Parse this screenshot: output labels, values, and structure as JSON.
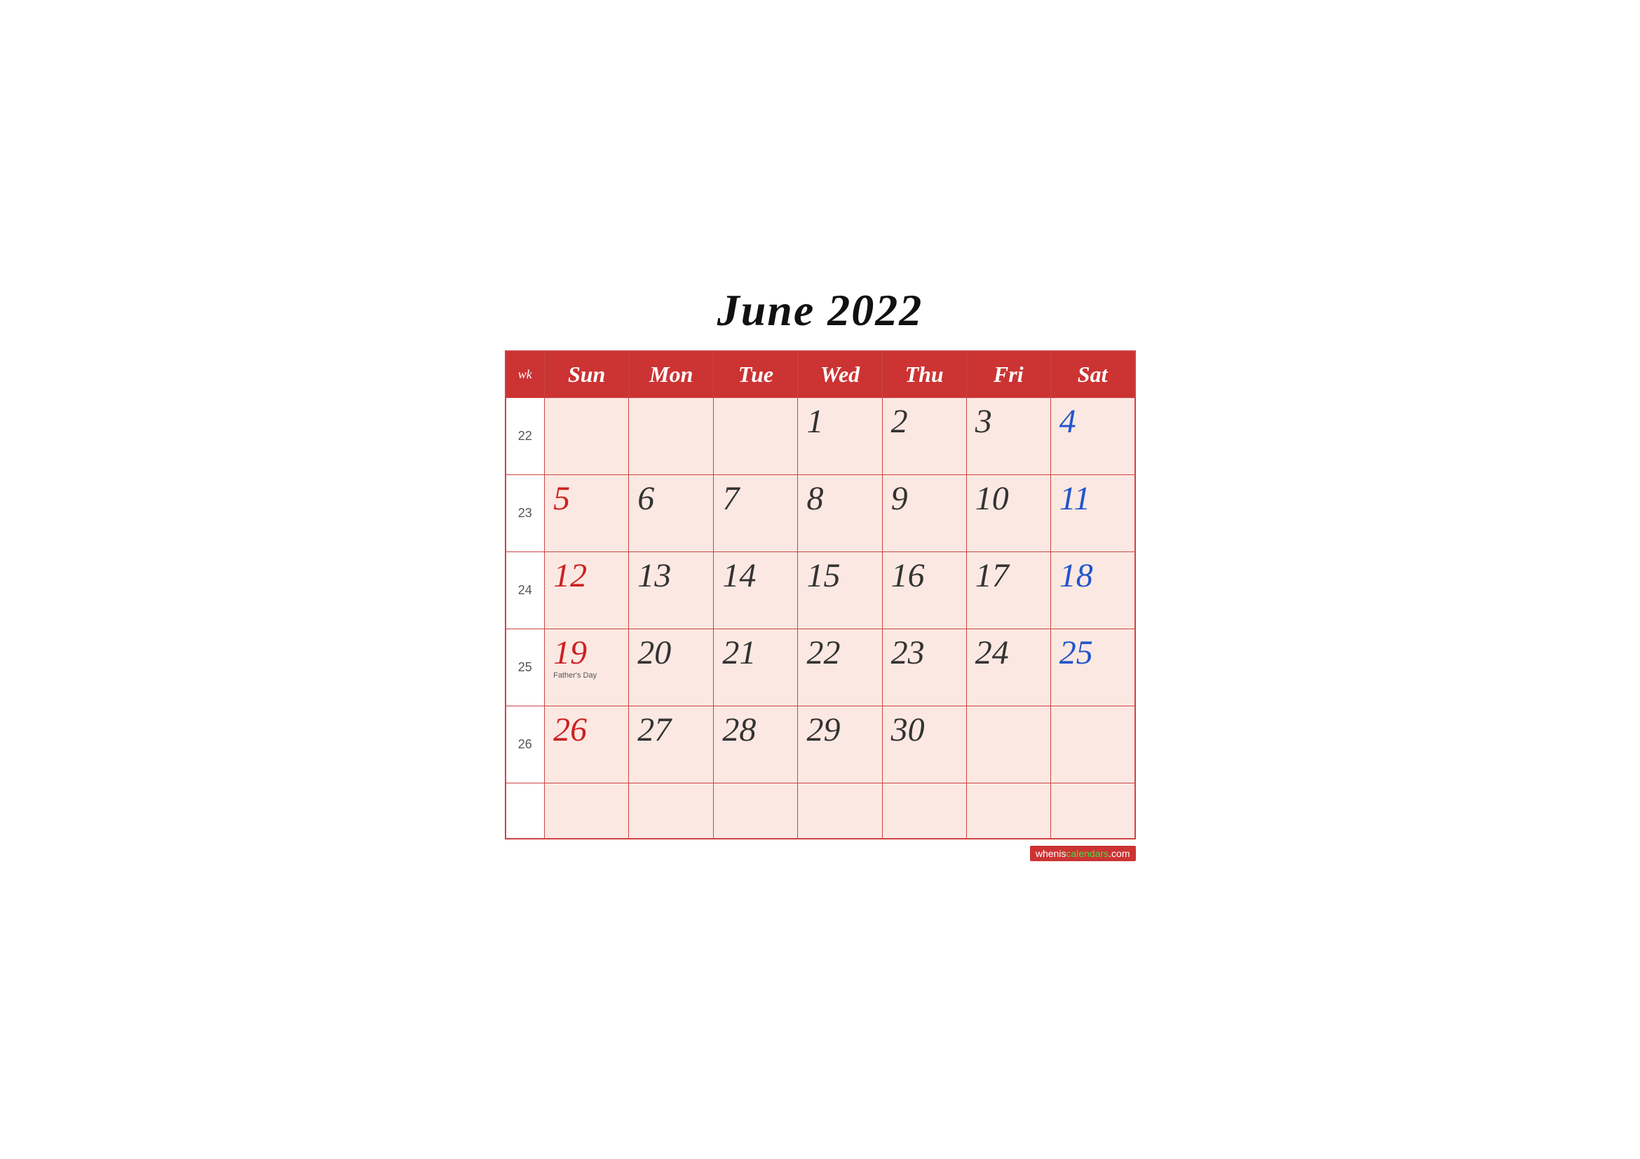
{
  "title": "June 2022",
  "header": {
    "wk": "wk",
    "days": [
      "Sun",
      "Mon",
      "Tue",
      "Wed",
      "Thu",
      "Fri",
      "Sat"
    ]
  },
  "weeks": [
    {
      "wk": "22",
      "days": [
        {
          "num": "",
          "type": "empty"
        },
        {
          "num": "",
          "type": "empty"
        },
        {
          "num": "",
          "type": "empty"
        },
        {
          "num": "1",
          "type": "weekday"
        },
        {
          "num": "2",
          "type": "weekday"
        },
        {
          "num": "3",
          "type": "weekday"
        },
        {
          "num": "4",
          "type": "saturday"
        }
      ]
    },
    {
      "wk": "23",
      "days": [
        {
          "num": "5",
          "type": "sunday"
        },
        {
          "num": "6",
          "type": "weekday"
        },
        {
          "num": "7",
          "type": "weekday"
        },
        {
          "num": "8",
          "type": "weekday"
        },
        {
          "num": "9",
          "type": "weekday"
        },
        {
          "num": "10",
          "type": "weekday"
        },
        {
          "num": "11",
          "type": "saturday"
        }
      ]
    },
    {
      "wk": "24",
      "days": [
        {
          "num": "12",
          "type": "sunday"
        },
        {
          "num": "13",
          "type": "weekday"
        },
        {
          "num": "14",
          "type": "weekday"
        },
        {
          "num": "15",
          "type": "weekday"
        },
        {
          "num": "16",
          "type": "weekday"
        },
        {
          "num": "17",
          "type": "weekday"
        },
        {
          "num": "18",
          "type": "saturday"
        }
      ]
    },
    {
      "wk": "25",
      "days": [
        {
          "num": "19",
          "type": "sunday",
          "event": "Father's Day"
        },
        {
          "num": "20",
          "type": "weekday"
        },
        {
          "num": "21",
          "type": "weekday"
        },
        {
          "num": "22",
          "type": "weekday"
        },
        {
          "num": "23",
          "type": "weekday"
        },
        {
          "num": "24",
          "type": "weekday"
        },
        {
          "num": "25",
          "type": "saturday"
        }
      ]
    },
    {
      "wk": "26",
      "days": [
        {
          "num": "26",
          "type": "sunday"
        },
        {
          "num": "27",
          "type": "weekday"
        },
        {
          "num": "28",
          "type": "weekday"
        },
        {
          "num": "29",
          "type": "weekday"
        },
        {
          "num": "30",
          "type": "weekday"
        },
        {
          "num": "",
          "type": "empty-end"
        },
        {
          "num": "",
          "type": "empty-end"
        }
      ]
    },
    {
      "wk": "",
      "days": [
        {
          "num": "",
          "type": "empty-end"
        },
        {
          "num": "",
          "type": "empty-end"
        },
        {
          "num": "",
          "type": "empty-end"
        },
        {
          "num": "",
          "type": "empty-end"
        },
        {
          "num": "",
          "type": "empty-end"
        },
        {
          "num": "",
          "type": "empty-end"
        },
        {
          "num": "",
          "type": "empty-end"
        }
      ]
    }
  ],
  "watermark": {
    "text": "wheniscalendars.com",
    "url": "#"
  }
}
